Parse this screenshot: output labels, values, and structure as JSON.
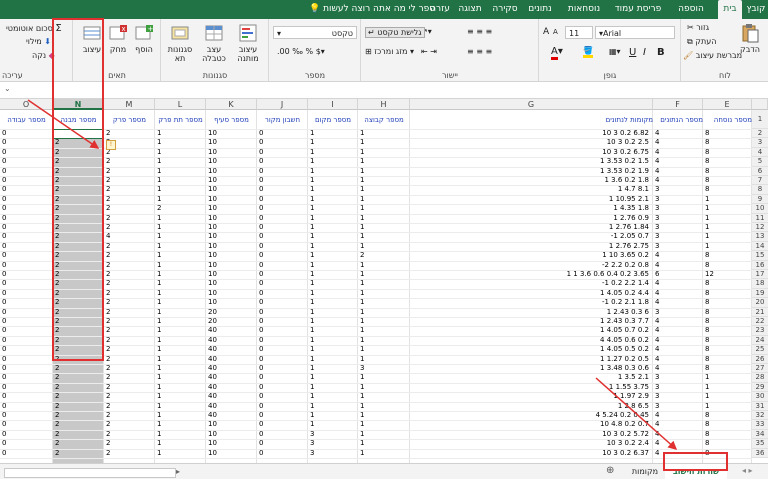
{
  "tabs": [
    {
      "label": "קובץ",
      "active": false
    },
    {
      "label": "בית",
      "active": true
    },
    {
      "label": "הוספה",
      "active": false
    },
    {
      "label": "פריסת עמוד",
      "active": false
    },
    {
      "label": "נוסחאות",
      "active": false
    },
    {
      "label": "נתונים",
      "active": false
    },
    {
      "label": "סקירה",
      "active": false
    },
    {
      "label": "תצוגה",
      "active": false
    },
    {
      "label": "עזרה",
      "active": false
    }
  ],
  "tellme": "ספר לי מה אתה רוצה לעשות",
  "ribbon": {
    "clipboard": {
      "label": "לוח",
      "paste": "הדבק",
      "cut": "גזור",
      "copy": "העתק",
      "format_painter": "מברשת עיצוב"
    },
    "font": {
      "label": "גופן",
      "font_name": "Arial",
      "font_size": "11"
    },
    "alignment": {
      "label": "יישור",
      "wrap": "גלישת טקסט",
      "merge": "מזג ומרכז"
    },
    "number": {
      "label": "מספר",
      "format": "טקסט"
    },
    "styles": {
      "label": "סגנונות",
      "conditional": "עיצוב מותנה",
      "as_table": "עצב כטבלה",
      "cell_styles": "סגנונות תא"
    },
    "cells": {
      "label": "תאים",
      "insert": "הוסף",
      "delete": "מחק",
      "format": "עיצוב"
    },
    "editing": {
      "label": "עריכה",
      "autosum": "סכום אוטומטי",
      "fill": "מילוי",
      "clear": "נקה"
    }
  },
  "columns": [
    {
      "letter": "O",
      "header": "מספר עבודה"
    },
    {
      "letter": "N",
      "header": "מספר מבנה"
    },
    {
      "letter": "M",
      "header": "מספר פרק"
    },
    {
      "letter": "L",
      "header": "מספר תת פרק"
    },
    {
      "letter": "K",
      "header": "מספר סעיף"
    },
    {
      "letter": "J",
      "header": "חשבון מקור"
    },
    {
      "letter": "I",
      "header": "מספר מקום"
    },
    {
      "letter": "H",
      "header": "מספר קבוצה"
    },
    {
      "letter": "G",
      "header": "מקומות לנתונים"
    },
    {
      "letter": "F",
      "header": "מספר הנתונים"
    },
    {
      "letter": "E",
      "header": "מספר נוסחה"
    }
  ],
  "rows": [
    {
      "n": "1",
      "O": "",
      "N": "",
      "M": "",
      "L": "",
      "K": "",
      "J": "",
      "I": "",
      "H": "",
      "G": "",
      "F": "",
      "E": ""
    },
    {
      "n": "2",
      "O": "0",
      "N": "2",
      "M": "2",
      "L": "1",
      "K": "10",
      "J": "0",
      "I": "1",
      "H": "1",
      "G": "10 3 0.2 6.82",
      "F": "4",
      "E": "8"
    },
    {
      "n": "3",
      "O": "0",
      "N": "2",
      "M": "2",
      "L": "1",
      "K": "10",
      "J": "0",
      "I": "1",
      "H": "1",
      "G": "10 3 0.2 2.5",
      "F": "4",
      "E": "8"
    },
    {
      "n": "4",
      "O": "0",
      "N": "2",
      "M": "2",
      "L": "1",
      "K": "10",
      "J": "0",
      "I": "1",
      "H": "1",
      "G": "10 3 0.2 6.75",
      "F": "4",
      "E": "8"
    },
    {
      "n": "5",
      "O": "0",
      "N": "2",
      "M": "2",
      "L": "1",
      "K": "10",
      "J": "0",
      "I": "1",
      "H": "1",
      "G": "1 3.53 0.2 1.5",
      "F": "4",
      "E": "8"
    },
    {
      "n": "6",
      "O": "0",
      "N": "2",
      "M": "2",
      "L": "1",
      "K": "10",
      "J": "0",
      "I": "1",
      "H": "1",
      "G": "1 3.53 0.2 1.9",
      "F": "4",
      "E": "8"
    },
    {
      "n": "7",
      "O": "0",
      "N": "2",
      "M": "2",
      "L": "1",
      "K": "10",
      "J": "0",
      "I": "1",
      "H": "1",
      "G": "1 3.6 0.2 1.8",
      "F": "4",
      "E": "8"
    },
    {
      "n": "8",
      "O": "0",
      "N": "2",
      "M": "2",
      "L": "1",
      "K": "10",
      "J": "0",
      "I": "1",
      "H": "1",
      "G": "1 4.7 8.1",
      "F": "3",
      "E": "8"
    },
    {
      "n": "9",
      "O": "0",
      "N": "2",
      "M": "2",
      "L": "1",
      "K": "10",
      "J": "0",
      "I": "1",
      "H": "1",
      "G": "1 10.95 2.1",
      "F": "3",
      "E": "1"
    },
    {
      "n": "10",
      "O": "0",
      "N": "2",
      "M": "2",
      "L": "2",
      "K": "10",
      "J": "0",
      "I": "1",
      "H": "1",
      "G": "1 4.35 1.8",
      "F": "3",
      "E": "1"
    },
    {
      "n": "11",
      "O": "0",
      "N": "2",
      "M": "2",
      "L": "1",
      "K": "10",
      "J": "0",
      "I": "1",
      "H": "1",
      "G": "1 2.76 0.9",
      "F": "3",
      "E": "1"
    },
    {
      "n": "12",
      "O": "0",
      "N": "2",
      "M": "2",
      "L": "1",
      "K": "10",
      "J": "0",
      "I": "1",
      "H": "1",
      "G": "1 2.76 1.84",
      "F": "3",
      "E": "1"
    },
    {
      "n": "13",
      "O": "0",
      "N": "2",
      "M": "4",
      "L": "1",
      "K": "10",
      "J": "0",
      "I": "1",
      "H": "1",
      "G": "-1 2.05 0.7",
      "F": "3",
      "E": "1"
    },
    {
      "n": "14",
      "O": "0",
      "N": "2",
      "M": "2",
      "L": "1",
      "K": "10",
      "J": "0",
      "I": "1",
      "H": "1",
      "G": "1 2.76 2.75",
      "F": "3",
      "E": "1"
    },
    {
      "n": "15",
      "O": "0",
      "N": "2",
      "M": "2",
      "L": "1",
      "K": "10",
      "J": "0",
      "I": "1",
      "H": "2",
      "G": "1 10 3.65 0.2",
      "F": "4",
      "E": "8"
    },
    {
      "n": "16",
      "O": "0",
      "N": "2",
      "M": "2",
      "L": "1",
      "K": "10",
      "J": "0",
      "I": "1",
      "H": "1",
      "G": "-2 2.2 0.2 0.8",
      "F": "4",
      "E": "8"
    },
    {
      "n": "17",
      "O": "0",
      "N": "2",
      "M": "2",
      "L": "1",
      "K": "10",
      "J": "0",
      "I": "1",
      "H": "1",
      "G": "1 1 3.6 0.6 0.4 0.2 3.65",
      "F": "6",
      "E": "12"
    },
    {
      "n": "18",
      "O": "0",
      "N": "2",
      "M": "2",
      "L": "1",
      "K": "10",
      "J": "0",
      "I": "1",
      "H": "1",
      "G": "-1 0.2 2.2 1.4",
      "F": "4",
      "E": "8"
    },
    {
      "n": "19",
      "O": "0",
      "N": "2",
      "M": "2",
      "L": "1",
      "K": "10",
      "J": "0",
      "I": "1",
      "H": "1",
      "G": "1 4.05 0.2 4.4",
      "F": "4",
      "E": "8"
    },
    {
      "n": "20",
      "O": "0",
      "N": "2",
      "M": "2",
      "L": "1",
      "K": "10",
      "J": "0",
      "I": "1",
      "H": "1",
      "G": "-1 0.2 2.1 1.8",
      "F": "4",
      "E": "8"
    },
    {
      "n": "21",
      "O": "0",
      "N": "2",
      "M": "2",
      "L": "1",
      "K": "20",
      "J": "0",
      "I": "1",
      "H": "1",
      "G": "1 2.43 0.3 6",
      "F": "3",
      "E": "8"
    },
    {
      "n": "22",
      "O": "0",
      "N": "2",
      "M": "2",
      "L": "1",
      "K": "20",
      "J": "0",
      "I": "1",
      "H": "1",
      "G": "1 2.43 0.3 7.7",
      "F": "4",
      "E": "8"
    },
    {
      "n": "23",
      "O": "0",
      "N": "2",
      "M": "2",
      "L": "1",
      "K": "40",
      "J": "0",
      "I": "1",
      "H": "1",
      "G": "1 4.05 0.7 0.2",
      "F": "4",
      "E": "8"
    },
    {
      "n": "24",
      "O": "0",
      "N": "2",
      "M": "2",
      "L": "1",
      "K": "40",
      "J": "0",
      "I": "1",
      "H": "1",
      "G": "4 4.05 0.6 0.2",
      "F": "4",
      "E": "8"
    },
    {
      "n": "25",
      "O": "0",
      "N": "2",
      "M": "2",
      "L": "1",
      "K": "40",
      "J": "0",
      "I": "1",
      "H": "1",
      "G": "1 4.05 0.5 0.2",
      "F": "4",
      "E": "8"
    },
    {
      "n": "26",
      "O": "0",
      "N": "2",
      "M": "2",
      "L": "1",
      "K": "40",
      "J": "0",
      "I": "1",
      "H": "1",
      "G": "1 1.27 0.2 0.5",
      "F": "4",
      "E": "8"
    },
    {
      "n": "27",
      "O": "0",
      "N": "2",
      "M": "2",
      "L": "1",
      "K": "40",
      "J": "0",
      "I": "1",
      "H": "3",
      "G": "1 3.48 0.3 0.6",
      "F": "4",
      "E": "8"
    },
    {
      "n": "28",
      "O": "0",
      "N": "2",
      "M": "2",
      "L": "1",
      "K": "40",
      "J": "0",
      "I": "1",
      "H": "1",
      "G": "1 3.5 2.1",
      "F": "3",
      "E": "1"
    },
    {
      "n": "29",
      "O": "0",
      "N": "2",
      "M": "2",
      "L": "1",
      "K": "40",
      "J": "0",
      "I": "1",
      "H": "1",
      "G": "1 1.55 3.75",
      "F": "3",
      "E": "1"
    },
    {
      "n": "30",
      "O": "0",
      "N": "2",
      "M": "2",
      "L": "1",
      "K": "40",
      "J": "0",
      "I": "1",
      "H": "1",
      "G": "1 1.97 2.9",
      "F": "3",
      "E": "1"
    },
    {
      "n": "31",
      "O": "0",
      "N": "2",
      "M": "2",
      "L": "1",
      "K": "40",
      "J": "0",
      "I": "1",
      "H": "1",
      "G": "1 2.8 6.5",
      "F": "3",
      "E": "1"
    },
    {
      "n": "32",
      "O": "0",
      "N": "2",
      "M": "2",
      "L": "1",
      "K": "40",
      "J": "0",
      "I": "1",
      "H": "1",
      "G": "4 5.24 0.2 0.45",
      "F": "4",
      "E": "8"
    },
    {
      "n": "33",
      "O": "0",
      "N": "2",
      "M": "2",
      "L": "1",
      "K": "10",
      "J": "0",
      "I": "1",
      "H": "1",
      "G": "10 4.8 0.2 0.7",
      "F": "4",
      "E": "8"
    },
    {
      "n": "34",
      "O": "0",
      "N": "2",
      "M": "2",
      "L": "1",
      "K": "10",
      "J": "0",
      "I": "3",
      "H": "1",
      "G": "10 3 0.2 5.72",
      "F": "4",
      "E": "8"
    },
    {
      "n": "35",
      "O": "0",
      "N": "2",
      "M": "2",
      "L": "1",
      "K": "10",
      "J": "0",
      "I": "3",
      "H": "1",
      "G": "10 3 0.2 2.4",
      "F": "4",
      "E": "8"
    },
    {
      "n": "36",
      "O": "0",
      "N": "2",
      "M": "2",
      "L": "1",
      "K": "10",
      "J": "0",
      "I": "3",
      "H": "1",
      "G": "10 3 0.2 6.37",
      "F": "4",
      "E": "8"
    }
  ],
  "sheet_tabs": [
    {
      "label": "שורות חישוב",
      "active": true
    },
    {
      "label": "מקומות",
      "active": false
    }
  ]
}
